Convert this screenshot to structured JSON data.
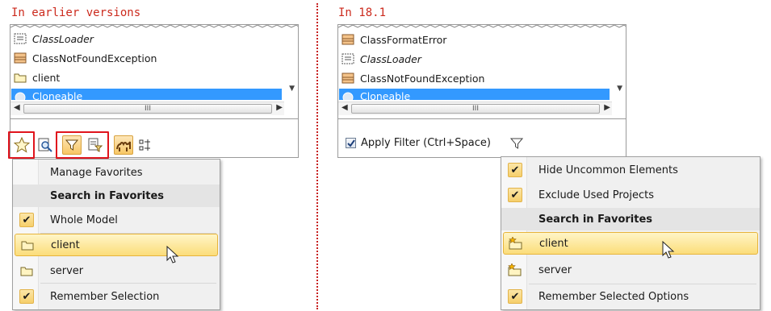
{
  "left_panel": {
    "heading": "In earlier versions",
    "list": [
      "ClassLoader",
      "ClassNotFoundException",
      "client",
      "Cloneable"
    ],
    "scroll_thumb": "III",
    "menu": {
      "items": [
        {
          "label": "Manage Favorites",
          "kind": "plain"
        },
        {
          "label": "Search in Favorites",
          "kind": "header"
        },
        {
          "label": "Whole Model",
          "kind": "checked"
        },
        {
          "label": "client",
          "kind": "folder-hot"
        },
        {
          "label": "server",
          "kind": "folder"
        },
        {
          "label": "Remember Selection",
          "kind": "checked"
        }
      ]
    }
  },
  "right_panel": {
    "heading": "In 18.1",
    "list": [
      "ClassFormatError",
      "ClassLoader",
      "ClassNotFoundException",
      "Cloneable"
    ],
    "scroll_thumb": "III",
    "apply_filter": "Apply Filter (Ctrl+Space)",
    "menu": {
      "items": [
        {
          "label": "Hide Uncommon Elements",
          "kind": "checked"
        },
        {
          "label": "Exclude Used Projects",
          "kind": "checked"
        },
        {
          "label": "Search in Favorites",
          "kind": "header"
        },
        {
          "label": "client",
          "kind": "folder-star-hot"
        },
        {
          "label": "server",
          "kind": "folder-star"
        },
        {
          "label": "Remember Selected Options",
          "kind": "checked"
        }
      ]
    }
  },
  "colors": {
    "heading": "#cc2a1d",
    "divider": "#c72020",
    "selection": "#3399ff",
    "highlight": "#fbdd7a",
    "red_box": "#e0141d"
  },
  "icons": {
    "class": "class-icon",
    "interface": "interface-icon",
    "package": "folder-icon",
    "favorite": "star-icon",
    "filter": "filter-icon"
  }
}
